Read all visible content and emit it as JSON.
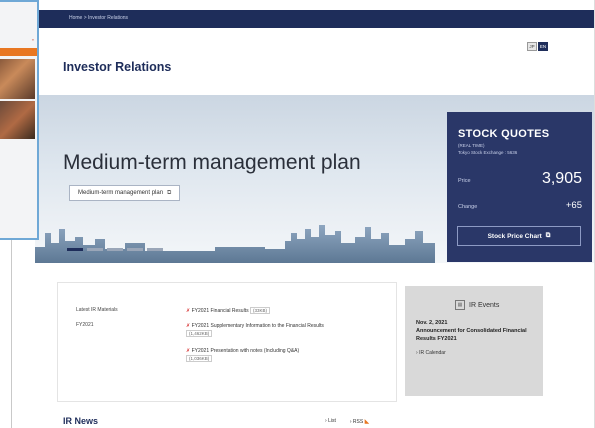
{
  "breadcrumb": "Home > Investor Relations",
  "lang": {
    "jp": "JP",
    "en": "EN"
  },
  "page_title": "Investor Relations",
  "hero": {
    "title": "Medium-term management plan",
    "tag_label": "Medium-term management plan",
    "tag_icon": "external-link-icon"
  },
  "stock": {
    "heading": "STOCK QUOTES",
    "sub1": "(REAL TIME)",
    "sub2": "Tokyo Stock Exchange : 5636",
    "price_label": "Price",
    "price_value": "3,905",
    "change_label": "Change",
    "change_value": "+65",
    "chart_button": "Stock Price Chart"
  },
  "materials": {
    "label": "Latest IR Materials",
    "year": "FY2021",
    "items": [
      {
        "text": "FY2021 Financial Results",
        "size": "(33KB)"
      },
      {
        "text": "FY2021 Supplementary Information to the Financial Results",
        "size": "(1,462KB)"
      },
      {
        "text": "FY2021 Presentation with notes (Including Q&A)",
        "size": "(1,036KB)"
      }
    ]
  },
  "events": {
    "heading": "IR Events",
    "date": "Nov. 2, 2021",
    "title": "Announcement for Consolidated Financial Results FY2021",
    "link": "IR Calendar"
  },
  "news": {
    "title": "IR News",
    "list": "List",
    "rss": "RSS"
  },
  "popup": {
    "link": "»"
  },
  "colors": {
    "navy": "#1e2d5a",
    "stock_bg": "#2a3768",
    "accent": "#e87722",
    "pdf": "#d62b2b"
  }
}
